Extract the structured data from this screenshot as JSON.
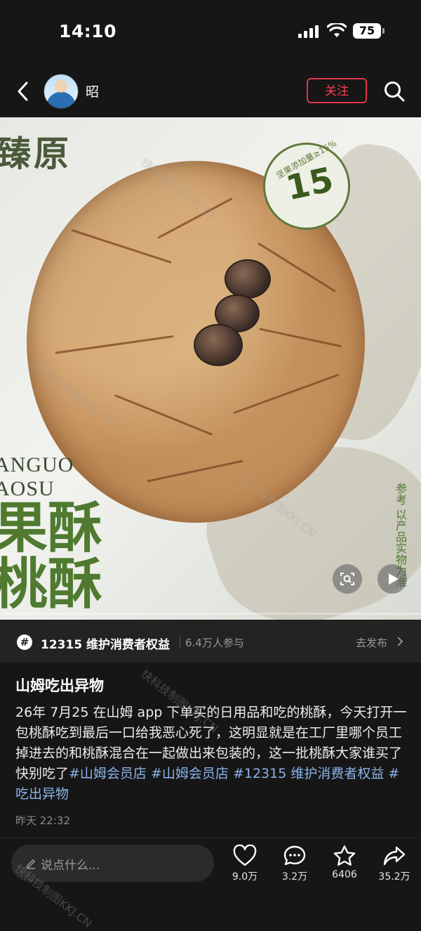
{
  "status_bar": {
    "time": "14:10",
    "battery": "75"
  },
  "header": {
    "username": "昭",
    "follow_label": "关注"
  },
  "photo": {
    "package_text_top": "臻原",
    "badge_number": "15",
    "badge_small": "坚果添加量≥15%",
    "package_en_1": "ANGUO",
    "package_en_2": "AOSU",
    "package_cn_1": "果酥",
    "package_cn_2": "桃酥",
    "package_side_note": "参考 以产品实物为准",
    "progress": 0.0
  },
  "watermark": "快科技制图KKJ.CN",
  "topic": {
    "icon": "#",
    "title": "12315 维护消费者权益",
    "count": "6.4万人参与",
    "action_label": "去发布"
  },
  "post": {
    "title": "山姆吃出异物",
    "body": "26年 7月25 在山姆 app 下单买的日用品和吃的桃酥，今天打开一包桃酥吃到最后一口给我恶心死了，这明显就是在工厂里哪个员工掉进去的和桃酥混合在一起做出来包装的，这一批桃酥大家谁买了快别吃了",
    "tags": [
      "#山姆会员店",
      "#山姆会员店",
      "#12315 维护消费者权益",
      "#吃出异物"
    ],
    "time": "昨天 22:32"
  },
  "bottom_bar": {
    "comment_placeholder": "说点什么...",
    "likes": "9.0万",
    "comments": "3.2万",
    "favorites": "6406",
    "shares": "35.2万"
  }
}
